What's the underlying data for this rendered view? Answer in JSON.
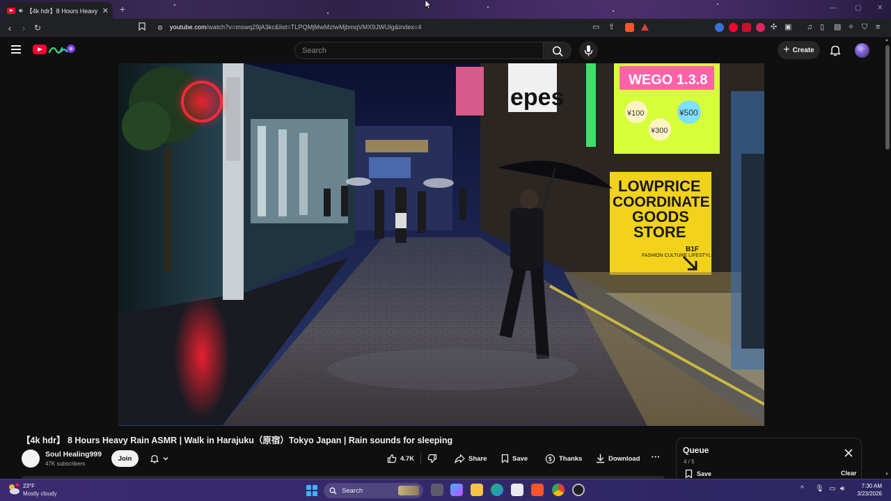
{
  "browser": {
    "tab_title": "【4k hdr】8 Hours Heavy Rain",
    "tab_audio_icon": "speaker-icon",
    "url_host": "youtube.com",
    "url_rest": "/watch?v=mswq29jA3kc&list=TLPQMjMwMzIwMjbmqVMX9JWUIg&index=4"
  },
  "youtube": {
    "search_placeholder": "Search",
    "create_label": "Create"
  },
  "video": {
    "title": "【4k hdr】 8 Hours Heavy Rain ASMR | Walk in Harajuku（原宿）Tokyo Japan | Rain sounds for sleeping",
    "store_sign_line1": "LOWPRICE",
    "store_sign_line2": "COORDINATE",
    "store_sign_line3": "GOODS",
    "store_sign_line4": "STORE",
    "store_sign_small": "FASHION CULTURE LIFESTYLE",
    "store_sign_floor": "B1F",
    "top_sign_text": "WEGO 1.3.8",
    "price_tags": [
      "¥100",
      "¥500",
      "¥300"
    ],
    "crepes_sign": "epes"
  },
  "channel": {
    "name": "Soul Healing999",
    "subscribers": "47K subscribers",
    "join_label": "Join"
  },
  "actions": {
    "likes": "4.7K",
    "share": "Share",
    "save": "Save",
    "thanks": "Thanks",
    "download": "Download"
  },
  "queue": {
    "title": "Queue",
    "count": "4 / 5",
    "save": "Save",
    "clear": "Clear"
  },
  "taskbar": {
    "weather_temp": "23°F",
    "weather_desc": "Mostly cloudy",
    "search_label": "Search",
    "time": "7:30 AM",
    "date": "3/23/2026"
  },
  "colors": {
    "yt_red": "#ff0033",
    "bg": "#0f0f0f",
    "sign_yellow": "#f2d21b"
  }
}
